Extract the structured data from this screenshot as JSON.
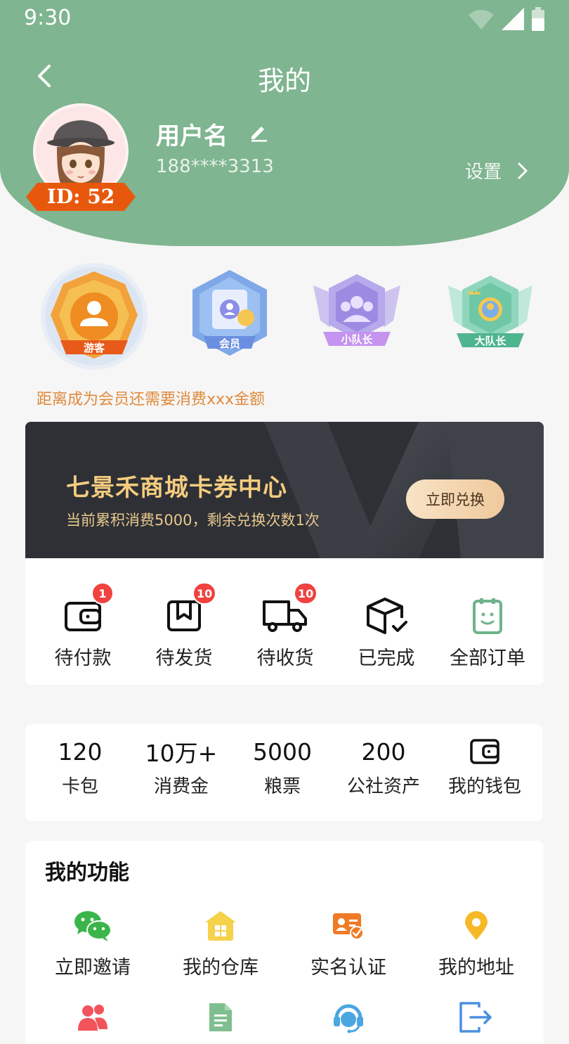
{
  "status_bar": {
    "time": "9:30"
  },
  "header": {
    "title": "我的"
  },
  "profile": {
    "id_label": "ID: 52",
    "username": "用户名",
    "phone": "188****3313",
    "settings_label": "设置"
  },
  "levels": [
    {
      "label": "游客"
    },
    {
      "label": "会员"
    },
    {
      "label": "小队长"
    },
    {
      "label": "大队长"
    }
  ],
  "level_tip": "距离成为会员还需要消费xxx金额",
  "banner": {
    "title": "七景禾商城卡券中心",
    "subtitle": "当前累积消费5000，剩余兑换次数1次",
    "button": "立即兑换"
  },
  "orders": [
    {
      "label": "待付款",
      "badge": "1"
    },
    {
      "label": "待发货",
      "badge": "10"
    },
    {
      "label": "待收货",
      "badge": "10"
    },
    {
      "label": "已完成"
    },
    {
      "label": "全部订单"
    }
  ],
  "stats": [
    {
      "value": "120",
      "label": "卡包"
    },
    {
      "value": "10万+",
      "label": "消费金"
    },
    {
      "value": "5000",
      "label": "粮票"
    },
    {
      "value": "200",
      "label": "公社资产"
    },
    {
      "label": "我的钱包"
    }
  ],
  "functions": {
    "title": "我的功能",
    "items": [
      {
        "label": "立即邀请"
      },
      {
        "label": "我的仓库"
      },
      {
        "label": "实名认证"
      },
      {
        "label": "我的地址"
      }
    ]
  },
  "colors": {
    "header_green": "#7fb590",
    "badge_red": "#f0423f",
    "banner_gold": "#f4cc7f",
    "tip_orange": "#e08a3c"
  }
}
